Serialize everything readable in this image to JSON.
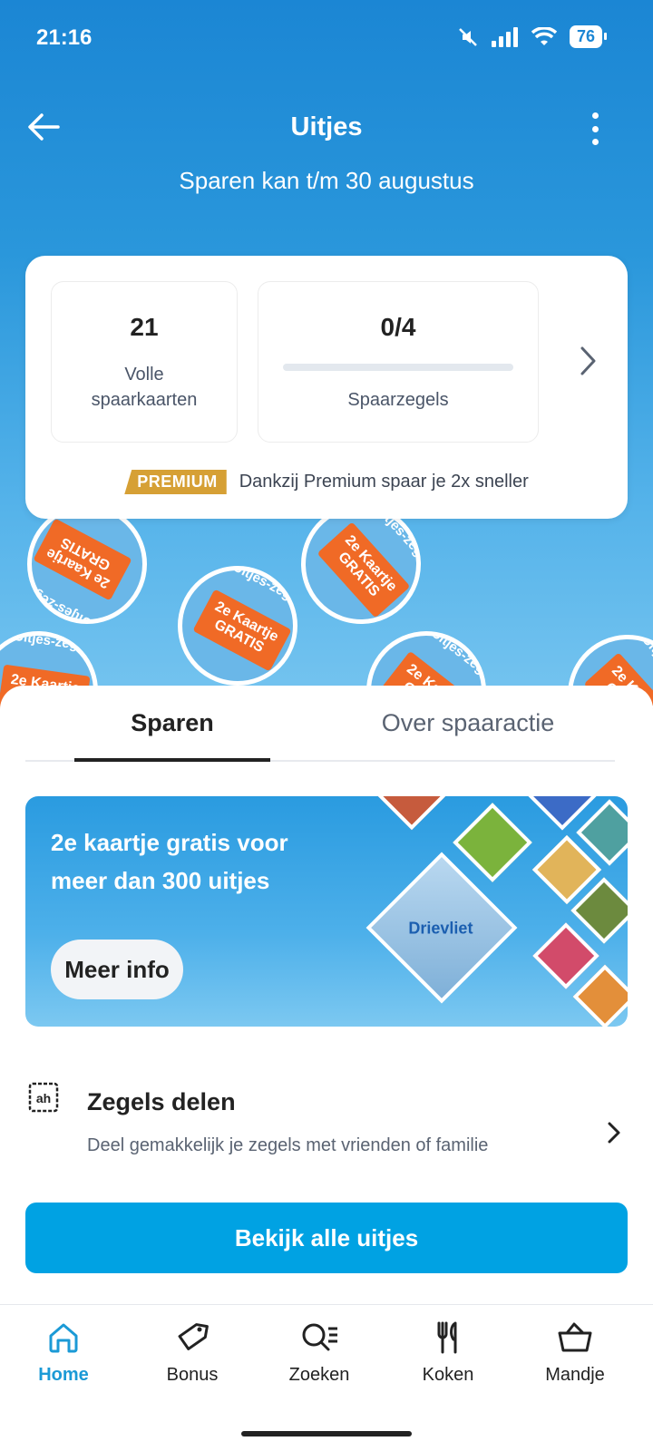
{
  "status": {
    "time": "21:16",
    "battery": "76"
  },
  "header": {
    "title": "Uitjes",
    "subtitle": "Sparen kan t/m 30 augustus"
  },
  "summary": {
    "cards_count": "21",
    "cards_label": "Volle spaarkaarten",
    "stamps_count": "0/4",
    "stamps_label": "Spaarzegels",
    "stamps_progress": 0,
    "premium_badge": "PREMIUM",
    "premium_text": "Dankzij Premium spaar je 2x sneller"
  },
  "stamp_art": {
    "ticket_text": "2e Kaartje GRATIS",
    "ring_text": "Uitjes-zegel"
  },
  "tabs": [
    {
      "label": "Sparen",
      "active": true
    },
    {
      "label": "Over spaaractie",
      "active": false
    }
  ],
  "promo": {
    "text": "2e kaartje gratis voor meer dan 300 uitjes",
    "button": "Meer info",
    "featured_park": "Drievliet"
  },
  "zegels": {
    "title": "Zegels delen",
    "description": "Deel gemakkelijk je zegels met vrienden of familie"
  },
  "cta": {
    "label": "Bekijk alle uitjes"
  },
  "nav": [
    {
      "label": "Home",
      "icon": "home-icon",
      "active": true
    },
    {
      "label": "Bonus",
      "icon": "tag-icon",
      "active": false
    },
    {
      "label": "Zoeken",
      "icon": "search-list-icon",
      "active": false
    },
    {
      "label": "Koken",
      "icon": "cutlery-icon",
      "active": false
    },
    {
      "label": "Mandje",
      "icon": "basket-icon",
      "active": false
    }
  ],
  "colors": {
    "primary": "#1b86d4",
    "cta": "#00a2e3",
    "premium": "#d6a035",
    "stamp_orange": "#f06a26"
  }
}
